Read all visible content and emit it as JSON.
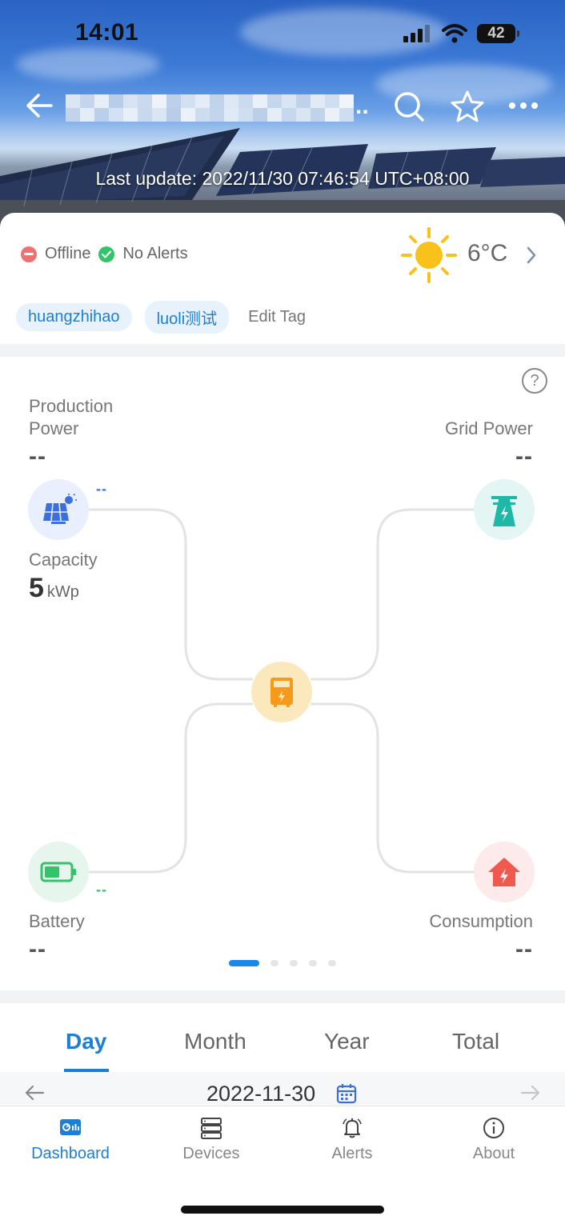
{
  "status_bar": {
    "time": "14:01",
    "battery_level": "42"
  },
  "header": {
    "last_update": "Last update: 2022/11/30 07:46:54 UTC+08:00",
    "title_ellipsis": "..",
    "icons": [
      "back-arrow-icon",
      "search-icon",
      "star-icon",
      "more-icon"
    ]
  },
  "status": {
    "connection": "Offline",
    "alerts": "No Alerts"
  },
  "weather": {
    "temperature": "6°C",
    "icon": "sun-icon"
  },
  "tags": {
    "items": [
      "huangzhihao",
      "luoli测试"
    ],
    "edit_label": "Edit Tag"
  },
  "flow": {
    "production_label_1": "Production",
    "production_label_2": "Power",
    "production_value": "--",
    "production_mini": "--",
    "grid_label": "Grid Power",
    "grid_value": "--",
    "capacity_label": "Capacity",
    "capacity_value": "5",
    "capacity_unit": "kWp",
    "battery_label": "Battery",
    "battery_value": "--",
    "battery_mini": "--",
    "consumption_label": "Consumption",
    "consumption_value": "--",
    "page_count": 5,
    "active_page": 1
  },
  "period_tabs": {
    "items": [
      "Day",
      "Month",
      "Year",
      "Total"
    ],
    "active": "Day"
  },
  "date_row": {
    "date": "2022-11-30"
  },
  "bottom_nav": {
    "items": [
      {
        "label": "Dashboard",
        "icon": "dashboard-icon",
        "active": true
      },
      {
        "label": "Devices",
        "icon": "devices-icon",
        "active": false
      },
      {
        "label": "Alerts",
        "icon": "bell-icon",
        "active": false
      },
      {
        "label": "About",
        "icon": "info-icon",
        "active": false
      }
    ]
  },
  "colors": {
    "accent": "#1b7fd8",
    "offline": "#f07070",
    "ok": "#35c26a",
    "solar_line": "#3b6fe0",
    "battery_line": "#35c26a"
  }
}
